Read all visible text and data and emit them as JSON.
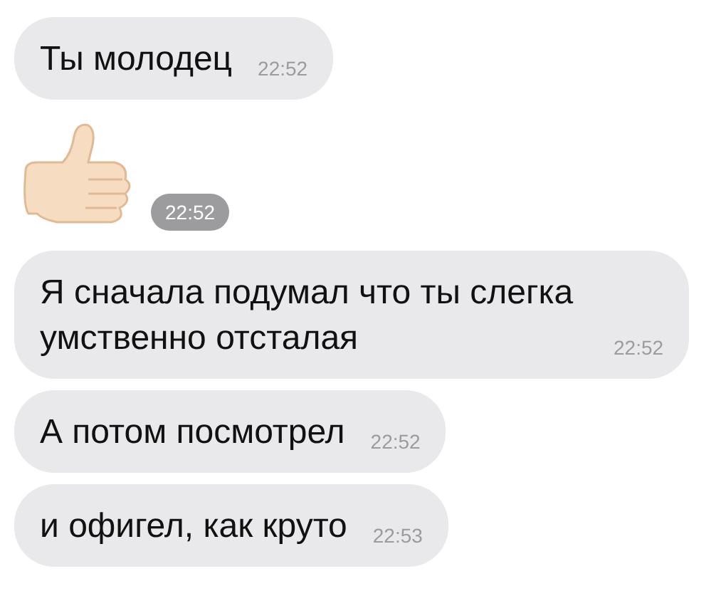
{
  "messages": [
    {
      "kind": "text",
      "text": "Ты молодец",
      "time": "22:52"
    },
    {
      "kind": "sticker",
      "time": "22:52"
    },
    {
      "kind": "text",
      "text": "Я сначала подумал что ты слегка умственно отсталая",
      "time": "22:52"
    },
    {
      "kind": "text",
      "text": "А потом посмотрел",
      "time": "22:52"
    },
    {
      "kind": "text",
      "text": "и офигел, как круто",
      "time": "22:53"
    }
  ]
}
